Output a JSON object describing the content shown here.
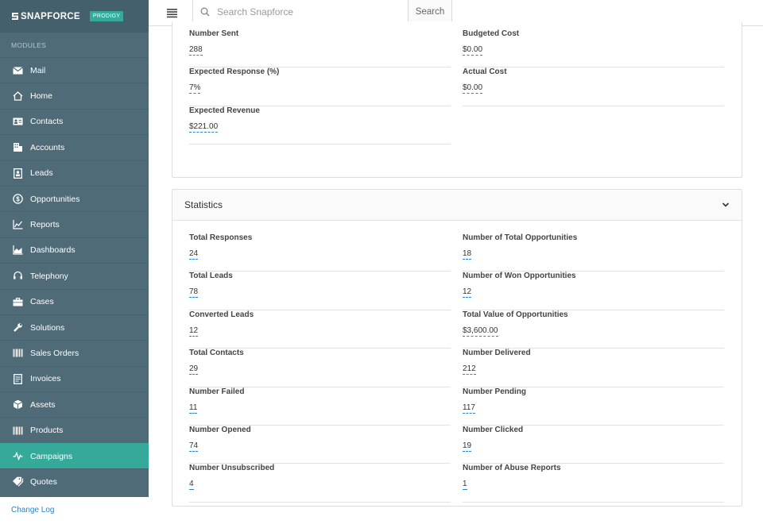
{
  "brand": {
    "name": "SNAPFORCE",
    "badge": "PRODIGY"
  },
  "sidebar": {
    "modules_label": "MODULES",
    "items": [
      {
        "label": "Mail",
        "icon": "envelope-icon"
      },
      {
        "label": "Home",
        "icon": "home-icon"
      },
      {
        "label": "Contacts",
        "icon": "contact-card-icon"
      },
      {
        "label": "Accounts",
        "icon": "building-icon"
      },
      {
        "label": "Leads",
        "icon": "lead-icon"
      },
      {
        "label": "Opportunities",
        "icon": "dollar-circle-icon"
      },
      {
        "label": "Reports",
        "icon": "line-chart-icon"
      },
      {
        "label": "Dashboards",
        "icon": "area-chart-icon"
      },
      {
        "label": "Telephony",
        "icon": "headset-icon"
      },
      {
        "label": "Cases",
        "icon": "briefcase-icon"
      },
      {
        "label": "Solutions",
        "icon": "wrench-icon"
      },
      {
        "label": "Sales Orders",
        "icon": "barcode-icon"
      },
      {
        "label": "Invoices",
        "icon": "invoice-icon"
      },
      {
        "label": "Assets",
        "icon": "cube-icon"
      },
      {
        "label": "Products",
        "icon": "barcode-icon"
      },
      {
        "label": "Campaigns",
        "icon": "pulse-icon",
        "active": true
      },
      {
        "label": "Quotes",
        "icon": "tags-icon"
      }
    ],
    "change_log": "Change Log"
  },
  "topbar": {
    "search_placeholder": "Search Snapforce",
    "search_button": "Search"
  },
  "campaign_fields": [
    {
      "label": "Number Sent",
      "value": "288"
    },
    {
      "label": "Budgeted Cost",
      "value": "$0.00"
    },
    {
      "label": "Expected Response (%)",
      "value": "7%"
    },
    {
      "label": "Actual Cost",
      "value": "$0.00"
    },
    {
      "label": "Expected Revenue",
      "value": "$221.00"
    }
  ],
  "statistics": {
    "title": "Statistics",
    "fields": [
      {
        "label": "Total Responses",
        "value": "24"
      },
      {
        "label": "Number of Total Opportunities",
        "value": "18"
      },
      {
        "label": "Total Leads",
        "value": "78"
      },
      {
        "label": "Number of Won Opportunities",
        "value": "12"
      },
      {
        "label": "Converted Leads",
        "value": "12"
      },
      {
        "label": "Total Value of Opportunities",
        "value": "$3,600.00"
      },
      {
        "label": "Total Contacts",
        "value": "29"
      },
      {
        "label": "Number Delivered",
        "value": "212"
      },
      {
        "label": "Number Failed",
        "value": "11"
      },
      {
        "label": "Number Pending",
        "value": "117"
      },
      {
        "label": "Number Opened",
        "value": "74"
      },
      {
        "label": "Number Clicked",
        "value": "19"
      },
      {
        "label": "Number Unsubscribed",
        "value": "4"
      },
      {
        "label": "Number of Abuse Reports",
        "value": "1"
      }
    ]
  },
  "colors": {
    "sidebar": "#4f6b78",
    "active": "#35a99a",
    "link": "#2a84c6"
  }
}
